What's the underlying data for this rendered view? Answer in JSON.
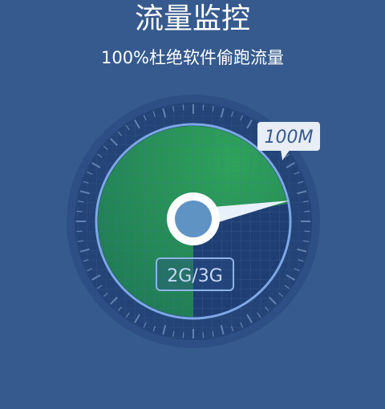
{
  "header": {
    "title": "流量监控",
    "subtitle": "100%杜绝软件偷跑流量"
  },
  "gauge": {
    "value_label": "100M",
    "network_label": "2G/3G",
    "needle_fraction": 0.72,
    "colors": {
      "background": "#365a8e",
      "dial_outer": "#2d4f85",
      "dial_inner": "#244477",
      "fill_green": "#2ea35a",
      "ring": "#7ea7e6",
      "tag_bg": "#e8edf6",
      "tag_text": "#365a8e"
    }
  }
}
